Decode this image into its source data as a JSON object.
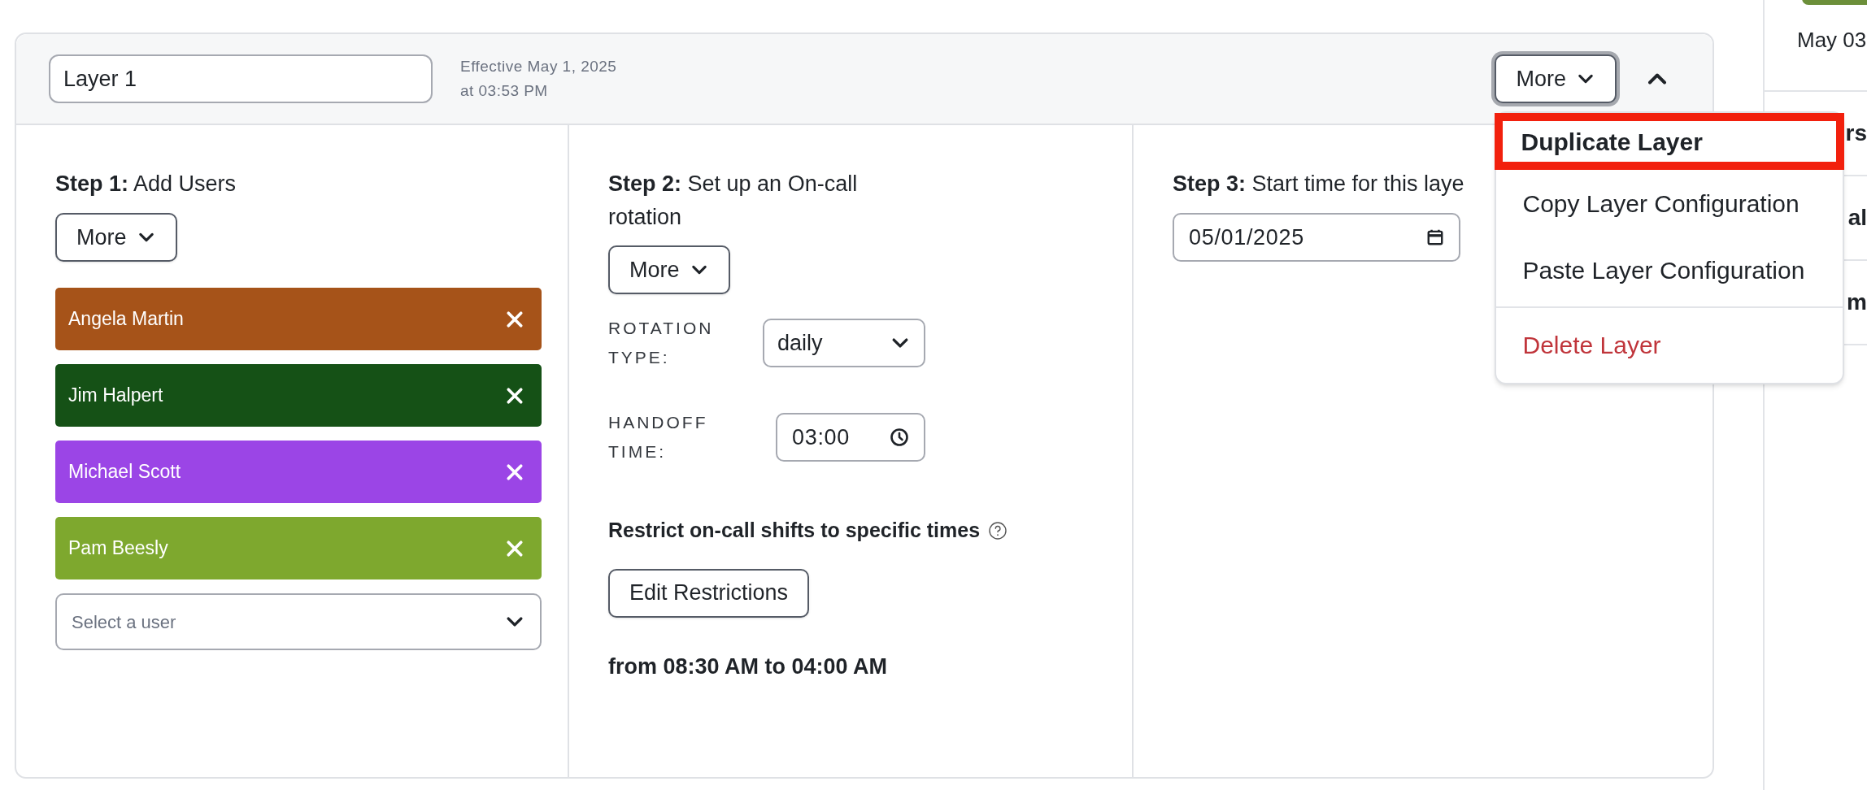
{
  "layer": {
    "name_value": "Layer 1",
    "effective": [
      "Effective May 1, 2025",
      "at 03:53 PM"
    ],
    "more_button": "More",
    "expanded": true
  },
  "step1": {
    "label": "Step 1:",
    "title": "Add Users",
    "more_button": "More",
    "select_placeholder": "Select a user",
    "users": [
      {
        "name": "Angela Martin",
        "color": "#a65319"
      },
      {
        "name": "Jim Halpert",
        "color": "#155116"
      },
      {
        "name": "Michael Scott",
        "color": "#9b45e6"
      },
      {
        "name": "Pam Beesly",
        "color": "#7ea82e"
      }
    ]
  },
  "step2": {
    "label": "Step 2:",
    "title": "Set up an On-call rotation",
    "more_button": "More",
    "rotation_type_label": "ROTATION TYPE:",
    "rotation_type": "daily",
    "handoff_label": "HANDOFF TIME:",
    "handoff_time": "03:00",
    "restrict_text": "Restrict on-call shifts to specific times",
    "edit_button": "Edit Restrictions",
    "restriction_summary": "from 08:30 AM to 04:00 AM"
  },
  "step3": {
    "label": "Step 3:",
    "title": "Start time for this laye",
    "date": "05/01/2025"
  },
  "menu": {
    "items": [
      {
        "label": "Duplicate Layer",
        "kind": "normal",
        "highlighted": true
      },
      {
        "label": "Copy Layer Configuration",
        "kind": "normal",
        "highlighted": false
      },
      {
        "label": "Paste Layer Configuration",
        "kind": "normal",
        "highlighted": false
      },
      {
        "label": "Delete Layer",
        "kind": "danger",
        "highlighted": false
      }
    ]
  },
  "side_panel": {
    "date": "May 03",
    "fragments": [
      "rs",
      "al",
      "m"
    ]
  }
}
